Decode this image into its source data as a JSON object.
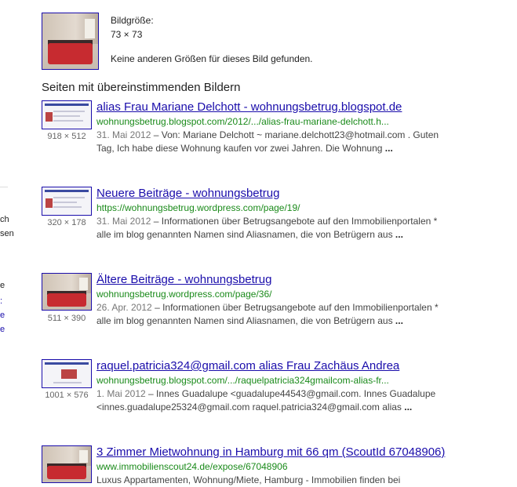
{
  "image_info": {
    "size_label": "Bildgröße:",
    "size_value": "73 × 73",
    "no_other_sizes": "Keine anderen Größen für dieses Bild gefunden."
  },
  "left_column_fragments": [
    "ch",
    "sen",
    "e",
    ":",
    "e",
    "e"
  ],
  "section_title": "Seiten mit übereinstimmenden Bildern",
  "results": [
    {
      "dims": "918 × 512",
      "title": "alias Frau Mariane Delchott - wohnungsbetrug.blogspot.de",
      "url": "wohnungsbetrug.blogspot.com/2012/.../alias-frau-mariane-delchott.h...",
      "date": "31. Mai 2012",
      "snippet": " – Von: Mariane Delchott ~ mariane.delchott23@hotmail.com . Guten Tag, Ich habe diese Wohnung kaufen vor zwei Jahren. Die Wohnung ",
      "ellipsis": "..."
    },
    {
      "dims": "320 × 178",
      "title": "Neuere Beiträge - wohnungsbetrug",
      "url": "https://wohnungsbetrug.wordpress.com/page/19/",
      "date": "31. Mai 2012",
      "snippet": " – Informationen über Betrugsangebote auf den Immobilienportalen * alle im blog genannten Namen sind Aliasnamen, die von Betrügern aus ",
      "ellipsis": "..."
    },
    {
      "dims": "511 × 390",
      "title": "Ältere Beiträge - wohnungsbetrug",
      "url": "wohnungsbetrug.wordpress.com/page/36/",
      "date": "26. Apr. 2012",
      "snippet": " – Informationen über Betrugsangebote auf den Immobilienportalen * alle im blog genannten Namen sind Aliasnamen, die von Betrügern aus ",
      "ellipsis": "..."
    },
    {
      "dims": "1001 × 576",
      "title": "raquel.patricia324@gmail.com alias Frau Zachäus Andrea",
      "url": "wohnungsbetrug.blogspot.com/.../raquelpatricia324gmailcom-alias-fr...",
      "date": "1. Mai 2012",
      "snippet": " – Innes Guadalupe <guadalupe44543@gmail.com. Innes Guadalupe <innes.guadalupe25324@gmail.com raquel.patricia324@gmail.com alias ",
      "ellipsis": "..."
    },
    {
      "dims": "",
      "title": "3 Zimmer Mietwohnung in Hamburg mit 66 qm (ScoutId 67048906)",
      "url": "www.immobilienscout24.de/expose/67048906",
      "date": "",
      "snippet": "Luxus Appartamenten, Wohnung/Miete, Hamburg - Immobilien finden bei",
      "ellipsis": ""
    }
  ]
}
